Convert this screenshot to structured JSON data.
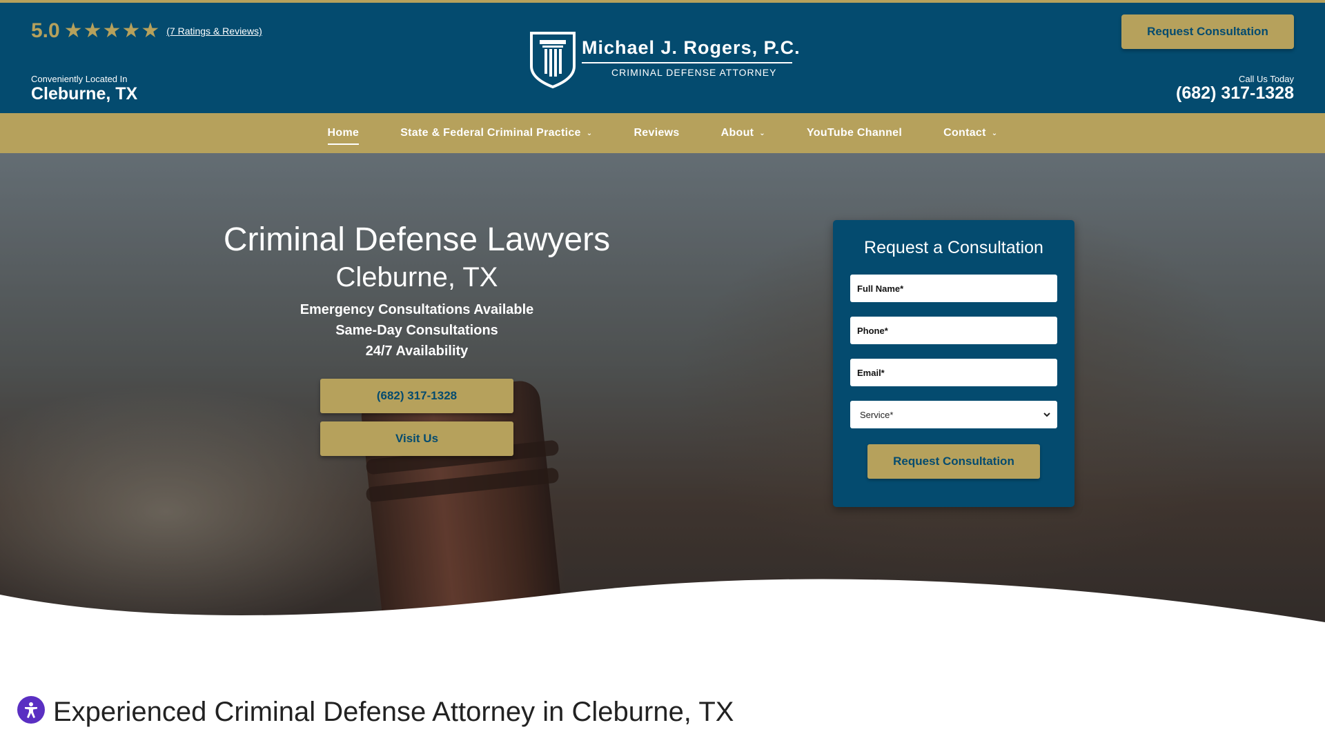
{
  "header": {
    "rating": {
      "score": "5.0",
      "stars": 5,
      "link_text": "(7 Ratings & Reviews)"
    },
    "location_label": "Conveniently Located In",
    "location_city": "Cleburne, TX",
    "logo": {
      "name": "Michael J. Rogers, P.C.",
      "subtitle": "CRIMINAL DEFENSE ATTORNEY"
    },
    "cta_label": "Request Consultation",
    "call_label": "Call Us Today",
    "phone": "(682) 317-1328"
  },
  "nav": {
    "items": [
      {
        "label": "Home",
        "dropdown": false,
        "active": true
      },
      {
        "label": "State & Federal Criminal Practice",
        "dropdown": true,
        "active": false
      },
      {
        "label": "Reviews",
        "dropdown": false,
        "active": false
      },
      {
        "label": "About",
        "dropdown": true,
        "active": false
      },
      {
        "label": "YouTube Channel",
        "dropdown": false,
        "active": false
      },
      {
        "label": "Contact",
        "dropdown": true,
        "active": false
      }
    ]
  },
  "hero": {
    "title": "Criminal Defense Lawyers",
    "city": "Cleburne, TX",
    "lines": [
      "Emergency Consultations Available",
      "Same-Day Consultations",
      "24/7 Availability"
    ],
    "phone_button": "(682) 317-1328",
    "visit_button": "Visit Us"
  },
  "form": {
    "title": "Request a Consultation",
    "name_placeholder": "Full Name*",
    "phone_placeholder": "Phone*",
    "email_placeholder": "Email*",
    "service_selected": "Service*",
    "submit_label": "Request Consultation"
  },
  "section": {
    "title": "Experienced Criminal Defense Attorney in Cleburne, TX"
  },
  "colors": {
    "navy": "#044b6f",
    "gold": "#b6a15c",
    "accessibility_purple": "#5a2fc2"
  }
}
